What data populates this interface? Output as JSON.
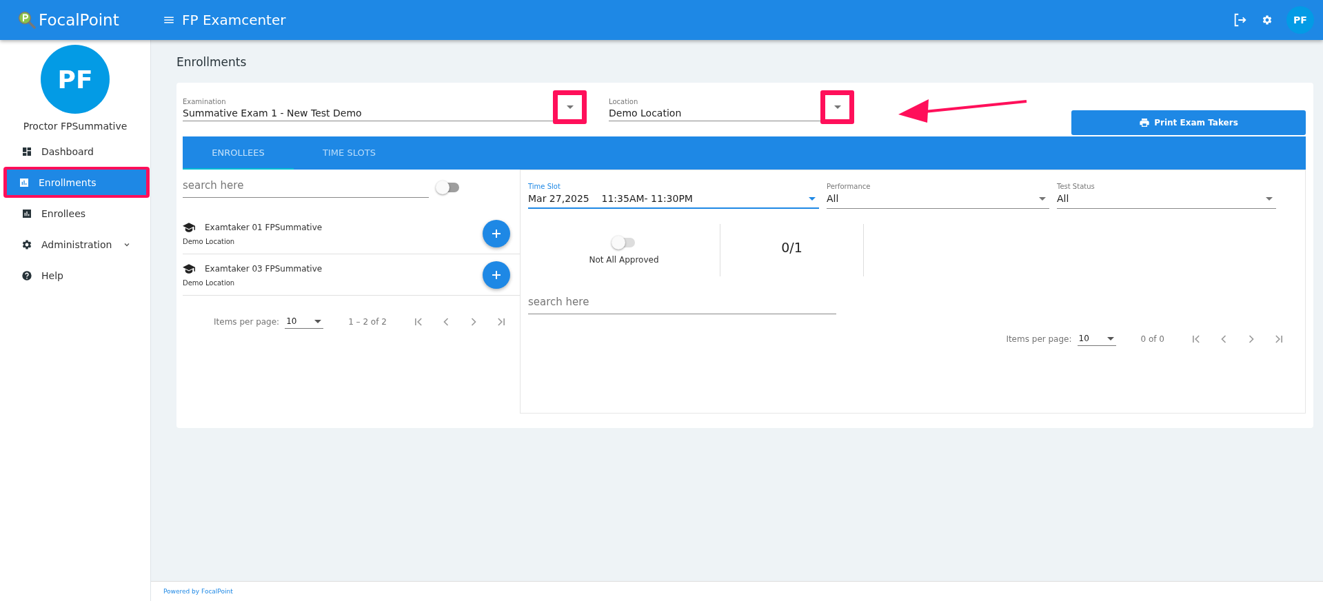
{
  "app": {
    "logo": "FocalPoint",
    "title": "FP Examcenter",
    "user_initials": "PF"
  },
  "sidebar": {
    "initials": "PF",
    "name": "Proctor FPSummative",
    "items": [
      {
        "label": "Dashboard",
        "kind": "dashboard",
        "selected": false,
        "highlighted": false,
        "expandable": false
      },
      {
        "label": "Enrollments",
        "kind": "chart",
        "selected": true,
        "highlighted": true,
        "expandable": false
      },
      {
        "label": "Enrollees",
        "kind": "chart",
        "selected": false,
        "highlighted": false,
        "expandable": false
      },
      {
        "label": "Administration",
        "kind": "gear",
        "selected": false,
        "highlighted": false,
        "expandable": true
      },
      {
        "label": "Help",
        "kind": "help",
        "selected": false,
        "highlighted": false,
        "expandable": false
      }
    ]
  },
  "page_title": "Enrollments",
  "filters": [
    {
      "label": "Examination",
      "value": "Summative Exam 1 - New Test Demo",
      "highlighted": true
    },
    {
      "label": "Location",
      "value": "Demo Location",
      "highlighted": true
    }
  ],
  "print_button": "Print Exam Takers",
  "tabs": [
    {
      "label": "ENROLLEES",
      "selected": true
    },
    {
      "label": "TIME SLOTS",
      "selected": false
    }
  ],
  "enrollees": {
    "search_placeholder": "search here",
    "toggle_on": false,
    "items": [
      {
        "name": "Examtaker 01 FPSummative",
        "location": "Demo Location"
      },
      {
        "name": "Examtaker 03 FPSummative",
        "location": "Demo Location"
      }
    ],
    "paginator": {
      "label": "Items per page:",
      "page_size": "10",
      "range": "1 – 2 of 2"
    }
  },
  "time_slots": {
    "selects": [
      {
        "label": "Time Slot",
        "value": "Mar 27,2025    11:35AM- 11:30PM",
        "focused": true
      },
      {
        "label": "Performance",
        "value": "All",
        "focused": false
      },
      {
        "label": "Test Status",
        "value": "All",
        "focused": false
      }
    ],
    "approval": {
      "on": false,
      "label": "Not All Approved"
    },
    "count": "0/1",
    "search_placeholder": "search here",
    "paginator": {
      "label": "Items per page:",
      "page_size": "10",
      "range": "0 of 0"
    }
  },
  "footer": "Powered by FocalPoint"
}
